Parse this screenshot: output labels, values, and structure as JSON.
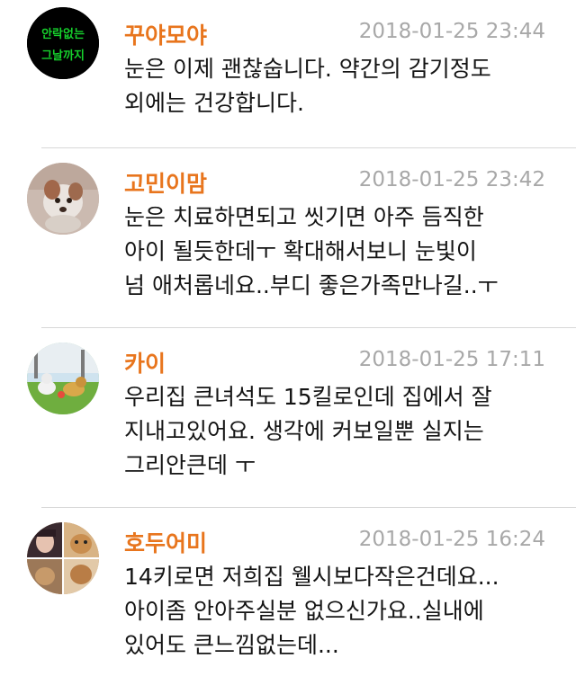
{
  "comments": [
    {
      "author": "꾸야모야",
      "timestamp": "2018-01-25 23:44",
      "lines": [
        "눈은 이제 괜찮숩니다. 약간의 감기정도",
        "외에는 건강합니다."
      ],
      "avatar": {
        "icon": "text-logo-avatar",
        "lettering": [
          "안락없는",
          "그날까지"
        ],
        "colors": [
          "#000000",
          "#16d12c"
        ]
      }
    },
    {
      "author": "고민이맘",
      "timestamp": "2018-01-25 23:42",
      "lines": [
        "눈은 치료하면되고 씻기면 아주 듬직한",
        "아이 될듯한데ㅜ 확대해서보니 눈빛이",
        "넘 애처롭네요..부디 좋은가족만나길..ㅜ"
      ],
      "avatar": {
        "icon": "puppy-photo-avatar"
      }
    },
    {
      "author": "카이",
      "timestamp": "2018-01-25 17:11",
      "lines": [
        "우리집 큰녀석도 15킬로인데 집에서 잘",
        "지내고있어요. 생각에 커보일뿐 실지는",
        "그리안큰데 ㅜ"
      ],
      "avatar": {
        "icon": "dogs-on-grass-photo-avatar"
      }
    },
    {
      "author": "호두어미",
      "timestamp": "2018-01-25 16:24",
      "lines": [
        "14키로면 저희집 웰시보다작은건데요...",
        "아이좀 안아주실분 없으신가요..실내에",
        "있어도 큰느낌없는데..."
      ],
      "avatar": {
        "icon": "collage-photo-avatar"
      }
    }
  ],
  "colors": {
    "author": "#e8751d",
    "timestamp": "#a8a8a8",
    "text": "#141414",
    "divider": "#d7d7d7"
  }
}
